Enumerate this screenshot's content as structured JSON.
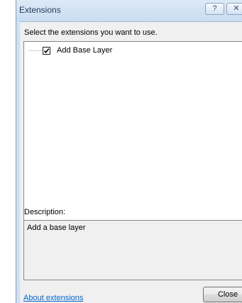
{
  "window": {
    "title": "Extensions",
    "help_glyph": "?",
    "close_glyph": "✕"
  },
  "main": {
    "prompt": "Select the extensions you want to use.",
    "extensions": [
      {
        "label": "Add Base Layer",
        "checked": true
      }
    ],
    "description_label": "Description:",
    "description_text": "Add a base layer"
  },
  "footer": {
    "about_link": "About extensions",
    "close_button": "Close"
  }
}
